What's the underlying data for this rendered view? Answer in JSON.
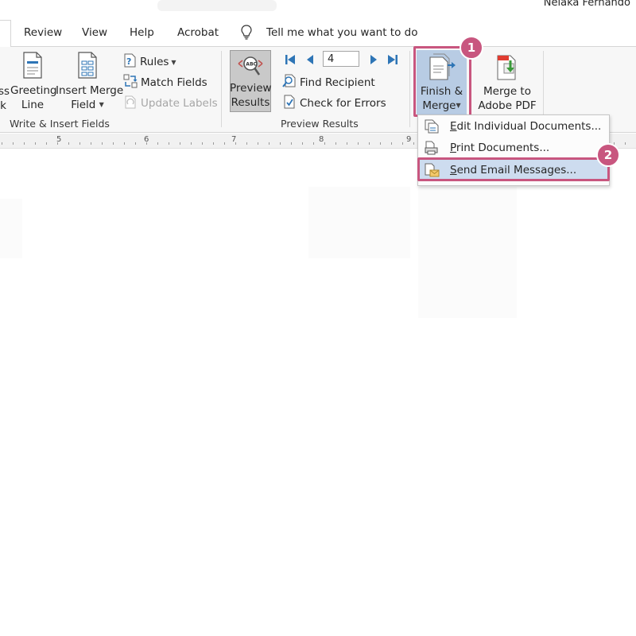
{
  "user": {
    "name": "Nelaka Fernando"
  },
  "tabs": [
    "Review",
    "View",
    "Help",
    "Acrobat"
  ],
  "tell_me": "Tell me what you want to do",
  "ribbon": {
    "cut_off_button": {
      "line1": "ss",
      "line2": "k"
    },
    "greeting_line": {
      "line1": "Greeting",
      "line2": "Line"
    },
    "insert_merge_field": {
      "line1": "Insert Merge",
      "line2": "Field"
    },
    "rules": "Rules",
    "match_fields": "Match Fields",
    "update_labels": "Update Labels",
    "write_insert_group": "Write & Insert Fields",
    "preview_results_button": {
      "line1": "Preview",
      "line2": "Results"
    },
    "record_number": "4",
    "find_recipient": "Find Recipient",
    "check_errors": "Check for Errors",
    "preview_results_group": "Preview Results",
    "finish_merge": {
      "line1": "Finish &",
      "line2": "Merge"
    },
    "merge_pdf": {
      "line1": "Merge to",
      "line2": "Adobe PDF"
    }
  },
  "ruler": [
    "5",
    "6",
    "7",
    "8",
    "9"
  ],
  "menu": {
    "items": [
      "Edit Individual Documents...",
      "Print Documents...",
      "Send Email Messages..."
    ]
  },
  "badges": [
    "1",
    "2"
  ],
  "colors": {
    "highlight": "#c8567f",
    "menu_selected": "#cddcef",
    "finish_selected": "#b8cce4",
    "nav_blue": "#2e75b6"
  },
  "icons": [
    "lightbulb-icon",
    "greeting-line-icon",
    "insert-merge-field-icon",
    "rules-icon",
    "match-fields-icon",
    "update-labels-icon",
    "preview-results-icon",
    "first-record-icon",
    "previous-record-icon",
    "next-record-icon",
    "last-record-icon",
    "find-recipient-icon",
    "check-errors-icon",
    "finish-merge-icon",
    "merge-pdf-icon",
    "edit-documents-icon",
    "print-documents-icon",
    "send-email-icon"
  ]
}
